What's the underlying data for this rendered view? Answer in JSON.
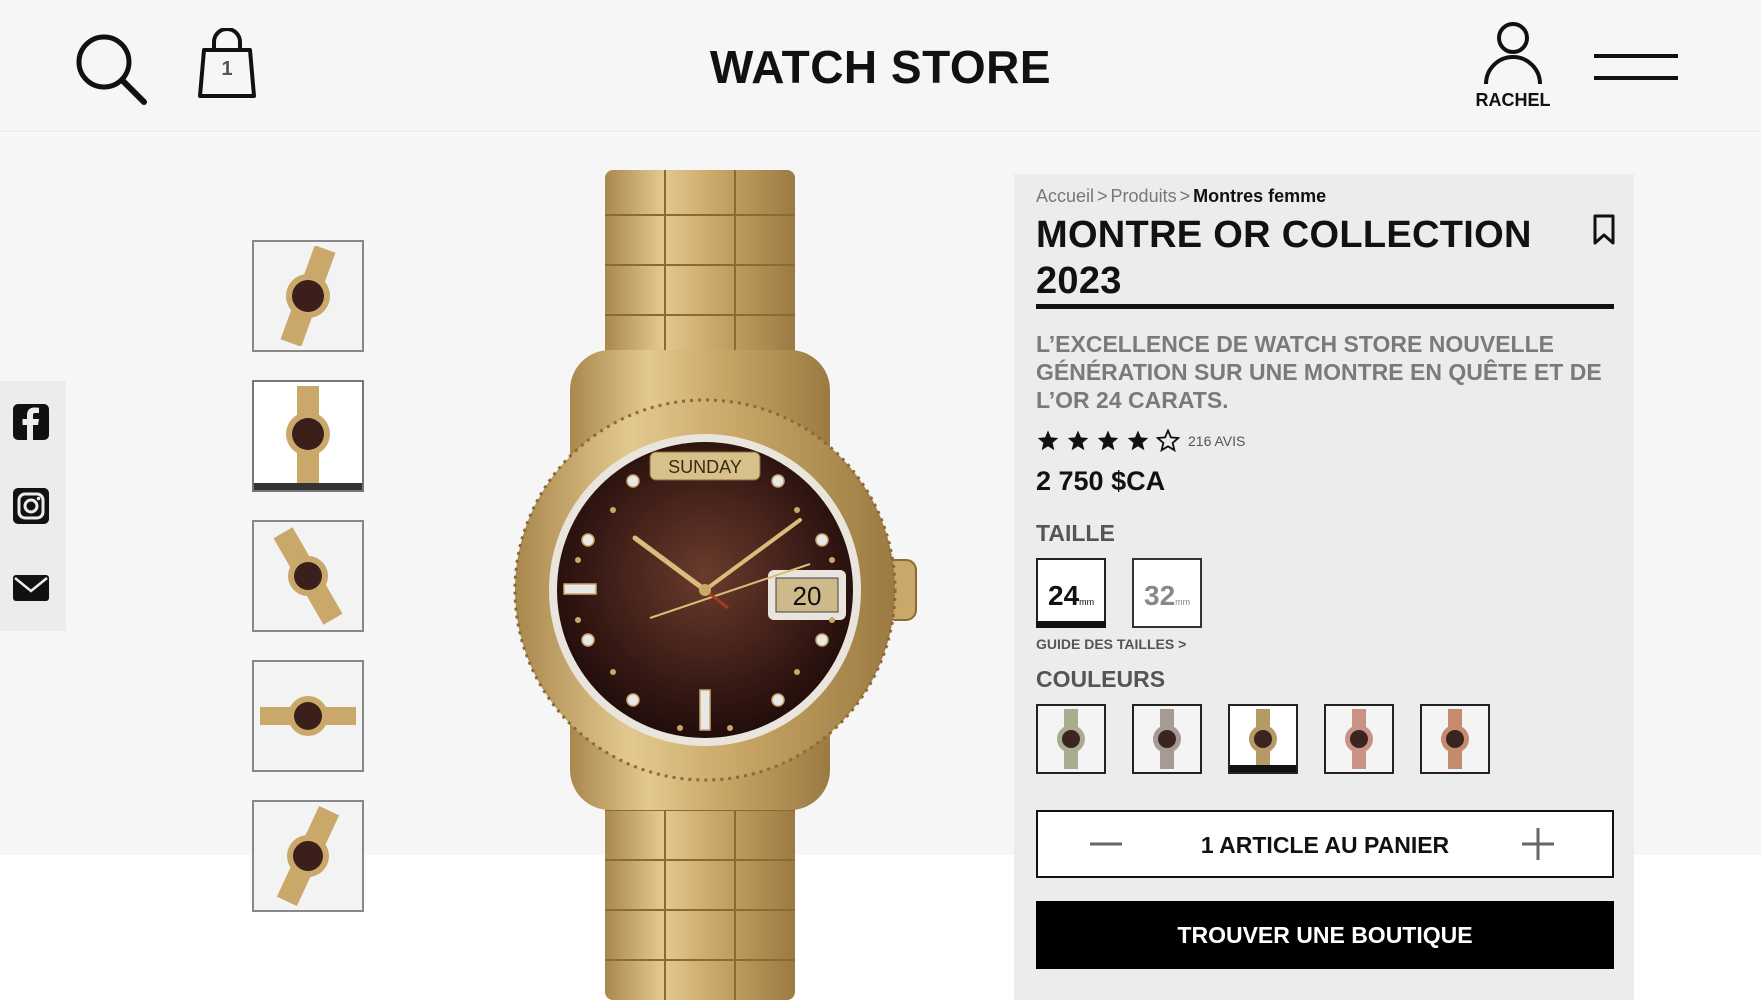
{
  "header": {
    "brand": "WATCH STORE",
    "bag_count": "1",
    "account_name": "RACHEL"
  },
  "breadcrumb": {
    "items": [
      "Accueil",
      "Produits"
    ],
    "current": "Montres femme",
    "separator": ">"
  },
  "product": {
    "title": "MONTRE OR COLLECTION 2023",
    "description": "L’EXCELLENCE DE WATCH STORE NOUVELLE GÉNÉRATION SUR UNE MONTRE EN QUÊTE ET DE L’OR 24 CARATS.",
    "rating": 4,
    "rating_max": 5,
    "reviews": "216 AVIS",
    "price": "2 750 $CA",
    "dial_day": "SUNDAY",
    "dial_date": "20"
  },
  "size": {
    "heading": "TAILLE",
    "options": [
      {
        "value": "24",
        "unit": "mm"
      },
      {
        "value": "32",
        "unit": "mm"
      }
    ],
    "guide": "GUIDE DES TAILLES >"
  },
  "colors": {
    "heading": "COULEURS",
    "swatches": [
      "#a9ad8f",
      "#a79a93",
      "#b59a66",
      "#c89384",
      "#c48b6c"
    ],
    "selected_index": 2
  },
  "cart": {
    "label": "1 ARTICLE AU PANIER"
  },
  "cta": {
    "label": "TROUVER UNE BOUTIQUE"
  },
  "thumbnails": {
    "count": 5,
    "active_index": 1
  },
  "social": [
    "facebook-icon",
    "instagram-icon",
    "mail-icon"
  ],
  "theme": {
    "gold": "#c9a86a",
    "dial": "#3a1f1a",
    "accent": "#000000"
  }
}
